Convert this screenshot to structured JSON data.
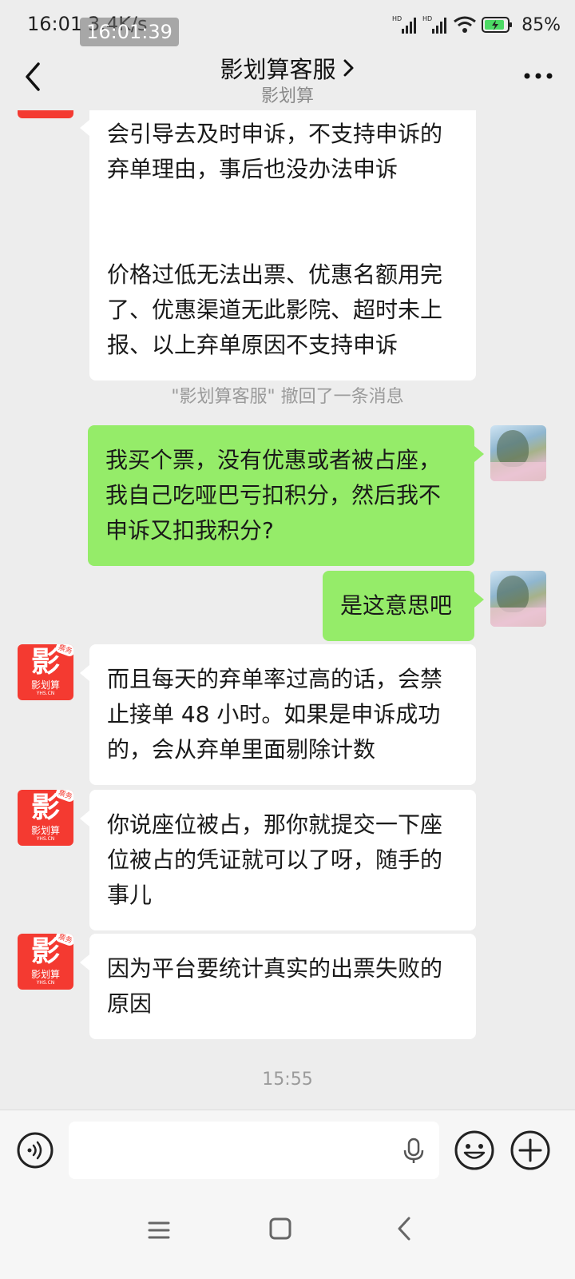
{
  "status_bar": {
    "time": "16:01",
    "net_speed": "3.4K/s",
    "overlay_time": "16:01:39",
    "signal_1_label": "HD",
    "signal_2_label": "HD",
    "battery": "85%"
  },
  "header": {
    "title": "影划算客服",
    "subtitle": "影划算"
  },
  "messages": [
    {
      "from": "them",
      "text": "会引导去及时申诉，不支持申诉的弃单理由，事后也没办法申诉\n\n\n价格过低无法出票、优惠名额用完了、优惠渠道无此影院、超时未上报、以上弃单原因不支持申诉"
    },
    {
      "from": "me",
      "text": "我买个票，没有优惠或者被占座，我自己吃哑巴亏扣积分，然后我不申诉又扣我积分?"
    },
    {
      "from": "me",
      "text": "是这意思吧"
    },
    {
      "from": "them",
      "text": "而且每天的弃单率过高的话，会禁止接单 48 小时。如果是申诉成功的，会从弃单里面剔除计数"
    },
    {
      "from": "them",
      "text": "你说座位被占，那你就提交一下座位被占的凭证就可以了呀，随手的事儿"
    },
    {
      "from": "them",
      "text": "因为平台要统计真实的出票失败的原因"
    }
  ],
  "system_notice": "\"影划算客服\" 撤回了一条消息",
  "timestamp": "15:55",
  "avatar": {
    "cs_logo_char": "影",
    "cs_logo_name": "影划算",
    "cs_logo_domain": "YHS.CN",
    "cs_logo_tag": "票务"
  },
  "input": {
    "placeholder": "",
    "value": ""
  },
  "colors": {
    "background": "#ededed",
    "my_bubble": "#95ec69",
    "their_bubble": "#ffffff",
    "brand_red": "#f43a31"
  },
  "icons": {
    "back": "chevron-left-icon",
    "more": "more-dots-icon",
    "voice": "voice-icon",
    "mic": "mic-icon",
    "emoji": "emoji-icon",
    "plus": "plus-icon"
  }
}
